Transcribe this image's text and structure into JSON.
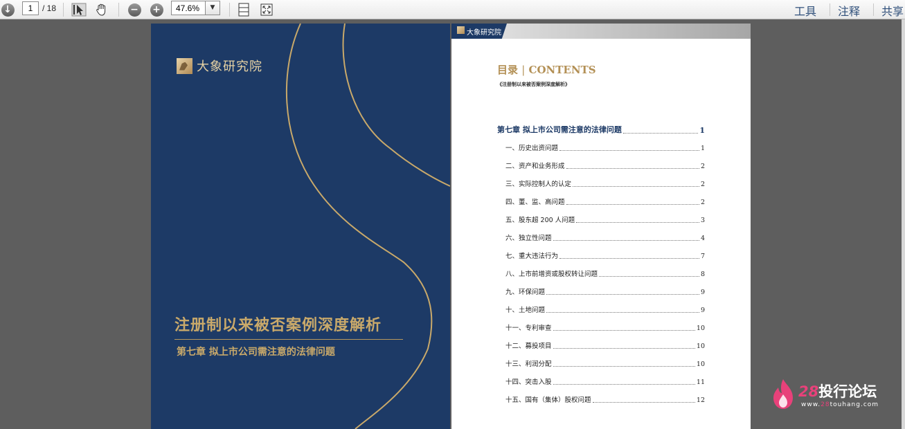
{
  "toolbar": {
    "page_current": "1",
    "page_total": "/ 18",
    "zoom": "47.6%",
    "tools_label": "工具",
    "comment_label": "注释",
    "share_label": "共享"
  },
  "cover": {
    "logo_text": "大象研究院",
    "title": "注册制以来被否案例深度解析",
    "subtitle": "第七章  拟上市公司需注意的法律问题"
  },
  "toc": {
    "header_brand": "大象研究院",
    "heading_cn": "目录",
    "heading_sep": "|",
    "heading_en": "CONTENTS",
    "book_title": "《注册制以来被否案例深度解析》",
    "chapter": {
      "label": "第七章  拟上市公司需注意的法律问题",
      "page": "1"
    },
    "items": [
      {
        "label": "一、历史出资问题",
        "page": "1"
      },
      {
        "label": "二、资产和业务形成",
        "page": "2"
      },
      {
        "label": "三、实际控制人的认定",
        "page": "2"
      },
      {
        "label": "四、董、监、高问题",
        "page": "2"
      },
      {
        "label": "五、股东超 200 人问题",
        "page": "3"
      },
      {
        "label": "六、独立性问题",
        "page": "4"
      },
      {
        "label": "七、重大违法行为",
        "page": "7"
      },
      {
        "label": "八、上市前增资或股权转让问题",
        "page": "8"
      },
      {
        "label": "九、环保问题",
        "page": "9"
      },
      {
        "label": "十、土地问题",
        "page": "9"
      },
      {
        "label": "十一、专利审查",
        "page": "10"
      },
      {
        "label": "十二、募投项目",
        "page": "10"
      },
      {
        "label": "十三、利润分配",
        "page": "10"
      },
      {
        "label": "十四、突击入股",
        "page": "11"
      },
      {
        "label": "十五、国有（集体）股权问题",
        "page": "12"
      }
    ]
  },
  "watermark": {
    "number": "28",
    "name": "投行论坛",
    "url_prefix": "www.",
    "url_highlight": "28",
    "url_suffix": "touhang.com"
  },
  "colors": {
    "cover_navy": "#1d3a66",
    "gold": "#c9a96a",
    "watermark_pink": "#e8417a"
  }
}
